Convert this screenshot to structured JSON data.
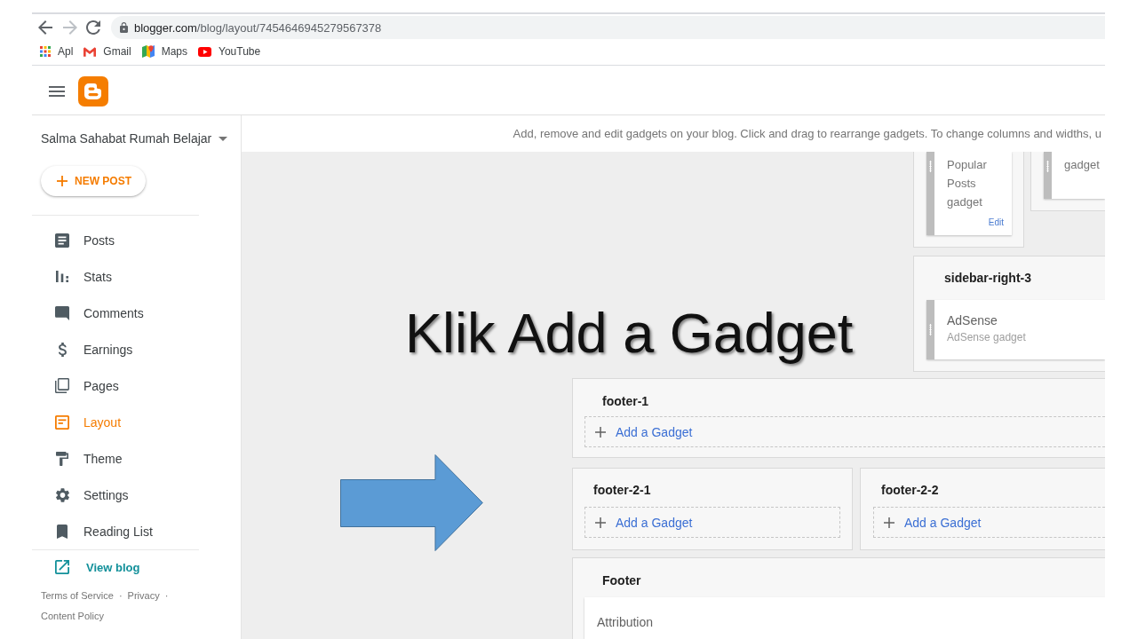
{
  "browser": {
    "url_host": "blogger.com",
    "url_path": "/blog/layout/7454646945279567378",
    "bookmarks": [
      {
        "label": "Apl",
        "kind": "apps"
      },
      {
        "label": "Gmail",
        "kind": "gmail"
      },
      {
        "label": "Maps",
        "kind": "maps"
      },
      {
        "label": "YouTube",
        "kind": "youtube"
      }
    ]
  },
  "sidebar": {
    "blog_name": "Salma Sahabat Rumah Belajar",
    "new_post": "NEW POST",
    "items": [
      {
        "label": "Posts",
        "kind": "posts",
        "selected": false
      },
      {
        "label": "Stats",
        "kind": "stats",
        "selected": false
      },
      {
        "label": "Comments",
        "kind": "comments",
        "selected": false
      },
      {
        "label": "Earnings",
        "kind": "earnings",
        "selected": false
      },
      {
        "label": "Pages",
        "kind": "pages",
        "selected": false
      },
      {
        "label": "Layout",
        "kind": "layout",
        "selected": true
      },
      {
        "label": "Theme",
        "kind": "theme",
        "selected": false
      },
      {
        "label": "Settings",
        "kind": "settings",
        "selected": false
      },
      {
        "label": "Reading List",
        "kind": "reading_list",
        "selected": false
      }
    ],
    "view_blog": "View blog",
    "footer_links": [
      {
        "label": "Terms of Service",
        "separator": "·"
      },
      {
        "label": "Privacy",
        "separator": "·"
      },
      {
        "label": "Content Policy"
      }
    ]
  },
  "layout": {
    "description": "Add, remove and edit gadgets on your blog. Click and drag to rearrange gadgets. To change columns and widths, u",
    "side_sections": [
      {
        "gadgets": [
          {
            "description": "Popular Posts gadget",
            "action": "Edit",
            "draggable": true
          }
        ]
      },
      {
        "gadgets": [
          {
            "description": "gadget",
            "draggable": true
          }
        ]
      }
    ],
    "sidebar_right_3": {
      "title": "sidebar-right-3",
      "gadgets": [
        {
          "name": "AdSense",
          "description": "AdSense gadget",
          "draggable": true
        }
      ]
    },
    "footer_1": {
      "title": "footer-1",
      "add_gadget": "Add a Gadget"
    },
    "footer_2": [
      {
        "title": "footer-2-1",
        "add_gadget": "Add a Gadget"
      },
      {
        "title": "footer-2-2",
        "add_gadget": "Add a Gadget"
      }
    ],
    "footer": {
      "title": "Footer",
      "gadgets": [
        {
          "name": "Attribution",
          "draggable": false
        }
      ]
    }
  },
  "overlay": {
    "caption": "Klik Add a Gadget"
  }
}
